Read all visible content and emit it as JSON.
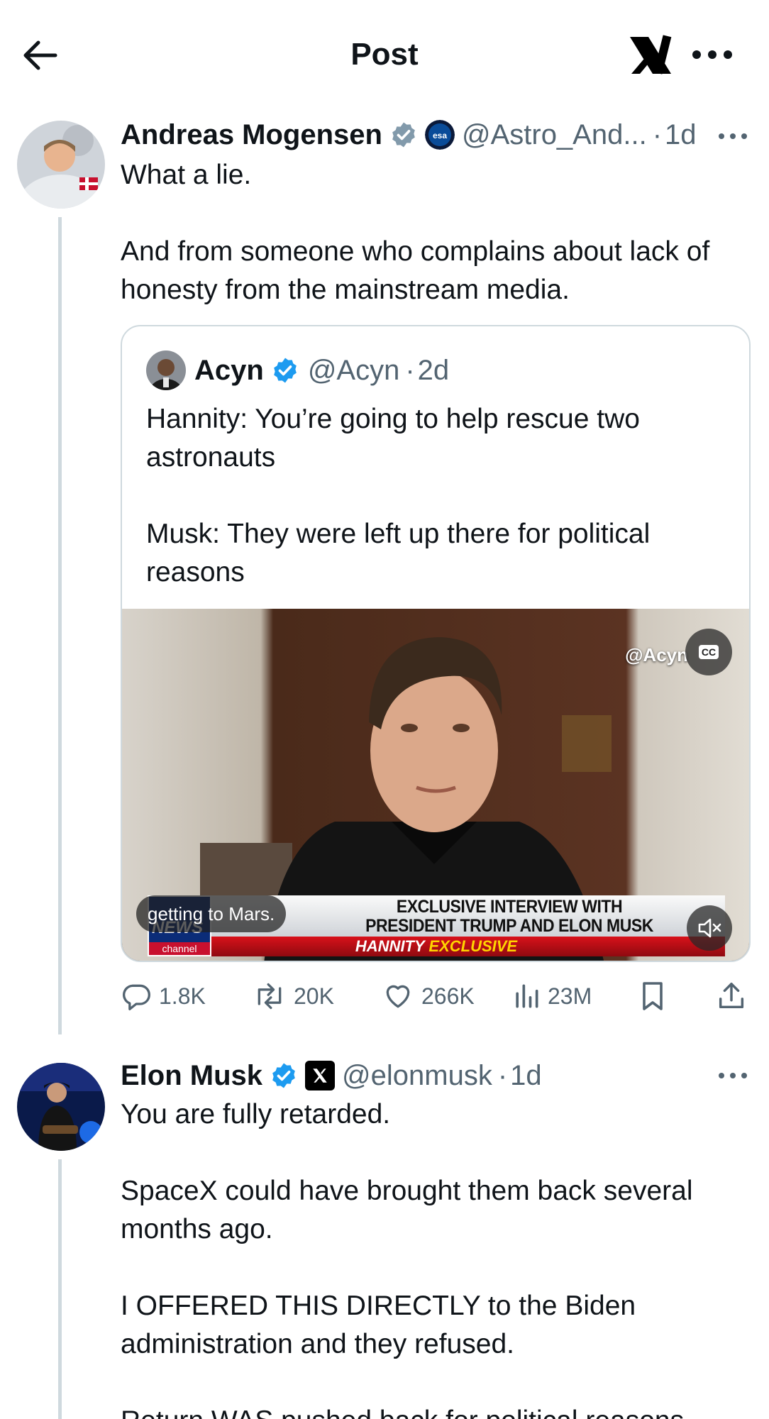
{
  "header": {
    "title": "Post"
  },
  "posts": [
    {
      "author_name": "Andreas Mogensen",
      "affiliate": "esa",
      "handle": "@Astro_And...",
      "time": "1d",
      "paragraphs": [
        "What a lie.",
        "And from someone who complains about lack of honesty from the mainstream media."
      ],
      "quote": {
        "author_name": "Acyn",
        "handle": "@Acyn",
        "time": "2d",
        "paragraphs": [
          "Hannity: You’re going to help rescue two astronauts",
          "Musk: They were left up there for political reasons"
        ],
        "video": {
          "watermark": "@Acyn",
          "cc": "CC",
          "caption": "getting to Mars.",
          "lower_third_line1": "EXCLUSIVE INTERVIEW WITH",
          "lower_third_line2": "PRESIDENT TRUMP AND ELON MUSK",
          "tag_show": "HANNITY",
          "tag_exclusive": "EXCLUSIVE",
          "logo_news": "NEWS",
          "logo_channel": "channel"
        }
      },
      "stats": {
        "replies": "1.8K",
        "reposts": "20K",
        "likes": "266K",
        "views": "23M"
      }
    },
    {
      "author_name": "Elon Musk",
      "handle": "@elonmusk",
      "time": "1d",
      "paragraphs": [
        "You are fully retarded.",
        "SpaceX could have brought them back several months ago.",
        "I OFFERED THIS DIRECTLY to the Biden administration and they refused.",
        "Return WAS pushed back for political reasons"
      ]
    }
  ],
  "colors": {
    "verified": "#1d9bf0",
    "verified_gray": "#829aab",
    "muted": "#536471",
    "text": "#0f1419",
    "line": "#cfd9de"
  }
}
